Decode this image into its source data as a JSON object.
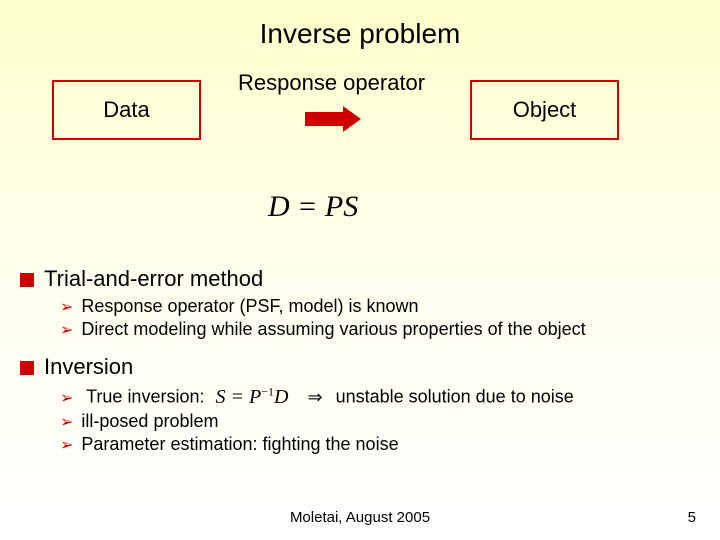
{
  "title": "Inverse problem",
  "diagram": {
    "data_label": "Data",
    "response_label": "Response operator",
    "object_label": "Object"
  },
  "equation_main": "D = PS",
  "sections": {
    "trial": {
      "heading": "Trial-and-error method",
      "sub1": "Response operator (PSF, model) is known",
      "sub2": "Direct modeling while assuming various properties of the object"
    },
    "inversion": {
      "heading": "Inversion",
      "true_inv_label": "True inversion:",
      "true_inv_eq_lhs": "S = P",
      "true_inv_eq_exp": "−1",
      "true_inv_eq_rhs": "D",
      "implies": "⇒",
      "true_inv_tail": "unstable solution due to noise",
      "sub2": "ill-posed problem",
      "sub3": "Parameter estimation: fighting the noise"
    }
  },
  "footer": "Moletai, August 2005",
  "page": "5"
}
